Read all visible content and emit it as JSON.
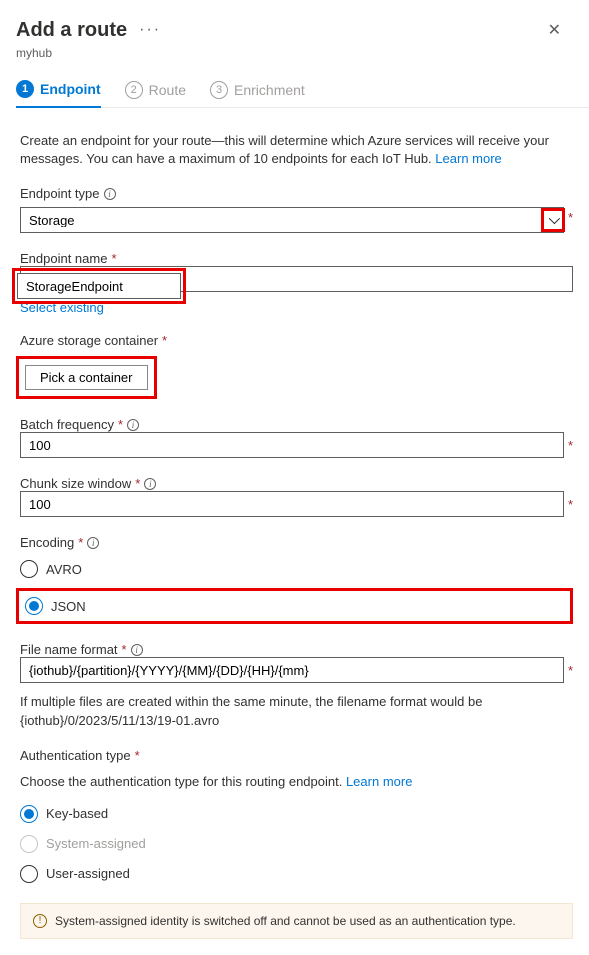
{
  "header": {
    "title": "Add a route",
    "subtitle": "myhub"
  },
  "stepper": {
    "steps": [
      {
        "num": "1",
        "label": "Endpoint"
      },
      {
        "num": "2",
        "label": "Route"
      },
      {
        "num": "3",
        "label": "Enrichment"
      }
    ]
  },
  "intro": {
    "text": "Create an endpoint for your route—this will determine which Azure services will receive your messages. You can have a maximum of 10 endpoints for each IoT Hub. ",
    "link": "Learn more"
  },
  "fields": {
    "endpoint_type": {
      "label": "Endpoint type",
      "value": "Storage"
    },
    "endpoint_name": {
      "label": "Endpoint name",
      "value": "StorageEndpoint",
      "select_existing": "Select existing"
    },
    "storage_container": {
      "label": "Azure storage container",
      "button": "Pick a container"
    },
    "batch_frequency": {
      "label": "Batch frequency",
      "value": "100"
    },
    "chunk_size": {
      "label": "Chunk size window",
      "value": "100"
    },
    "encoding": {
      "label": "Encoding",
      "options": [
        {
          "label": "AVRO",
          "checked": false
        },
        {
          "label": "JSON",
          "checked": true
        }
      ]
    },
    "file_format": {
      "label": "File name format",
      "value": "{iothub}/{partition}/{YYYY}/{MM}/{DD}/{HH}/{mm}",
      "note": "If multiple files are created within the same minute, the filename format would be {iothub}/0/2023/5/11/13/19-01.avro"
    },
    "auth_type": {
      "label": "Authentication type",
      "prompt": "Choose the authentication type for this routing endpoint. ",
      "link": "Learn more",
      "options": [
        {
          "label": "Key-based",
          "checked": true,
          "disabled": false
        },
        {
          "label": "System-assigned",
          "checked": false,
          "disabled": true
        },
        {
          "label": "User-assigned",
          "checked": false,
          "disabled": false
        }
      ]
    }
  },
  "warning": "System-assigned identity is switched off and cannot be used as an authentication type."
}
